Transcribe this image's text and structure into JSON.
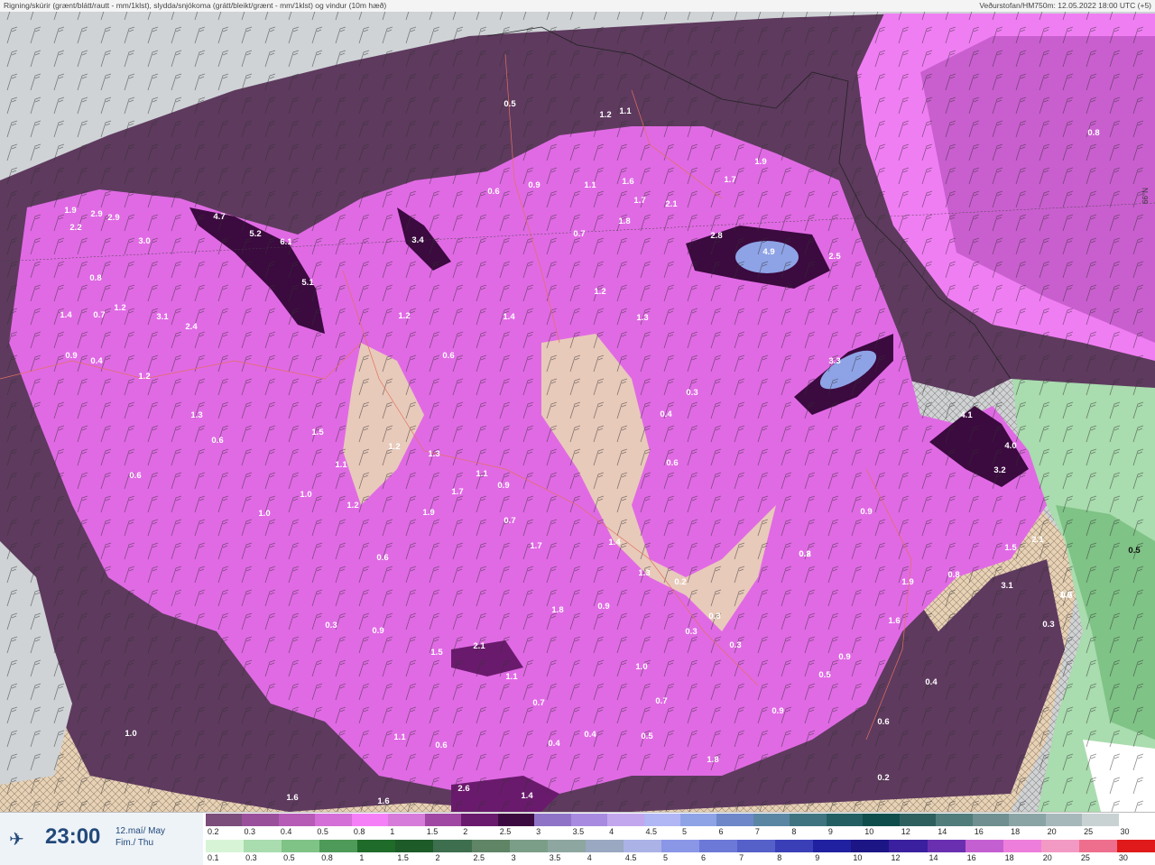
{
  "header": {
    "title": "Rigning/skúrir (grænt/blátt/rautt - mm/1klst), slydda/snjókoma (grátt/bleikt/grænt - mm/1klst) og vindur (10m hæð)",
    "source": "Veðurstofan/HM750m: 12.05.2022 18:00 UTC (+5)"
  },
  "time_panel": {
    "plane_icon": "airplane-icon",
    "time": "23:00",
    "date_line1": "12.maí/ May",
    "date_line2": "Fim./ Thu"
  },
  "grid_label": "66°N",
  "colors": {
    "sea": "#cfd3d6",
    "land": "#e8d2b6",
    "precip_light": "#5e3a5e",
    "precip_mid": "#e06ae4",
    "precip_bright": "#f07ef3",
    "precip_heavy": "#2e0a2e",
    "rain_green": "#a9dcae"
  },
  "legend_snow": {
    "labels": [
      "0.2",
      "0.3",
      "0.4",
      "0.5",
      "0.8",
      "1",
      "1.5",
      "2",
      "2.5",
      "3",
      "3.5",
      "4",
      "4.5",
      "5",
      "6",
      "7",
      "8",
      "9",
      "10",
      "12",
      "14",
      "16",
      "18",
      "20",
      "25",
      "30"
    ],
    "colors": [
      "#7a4d7a",
      "#9a4f9a",
      "#b65bb6",
      "#d36fd6",
      "#f57ff7",
      "#d67bd9",
      "#9f47a2",
      "#6a1a6d",
      "#3b0a3f",
      "#8e73c7",
      "#a88be0",
      "#c3a7ee",
      "#b1b6f5",
      "#8ea3e6",
      "#6d87c8",
      "#5a86a3",
      "#3f7380",
      "#235e62",
      "#0f4d4d",
      "#2e5f5f",
      "#507c7c",
      "#6f8f90",
      "#8aa4a6",
      "#a7b8ba",
      "#c9d2d3",
      "#ffffff"
    ]
  },
  "legend_rain": {
    "labels": [
      "0.1",
      "0.3",
      "0.5",
      "0.8",
      "1",
      "1.5",
      "2",
      "2.5",
      "3",
      "3.5",
      "4",
      "4.5",
      "5",
      "6",
      "7",
      "8",
      "9",
      "10",
      "12",
      "14",
      "16",
      "18",
      "20",
      "25",
      "30"
    ],
    "colors": [
      "#d7f5d6",
      "#a9dcae",
      "#7fc386",
      "#4e9a58",
      "#1f6b2a",
      "#1d5b28",
      "#3d6f4f",
      "#5f8466",
      "#7b9e88",
      "#8ea6a0",
      "#9aa8c2",
      "#aab2e6",
      "#8a96e6",
      "#6c79d6",
      "#5560c9",
      "#3a3fb8",
      "#2021a0",
      "#1c1586",
      "#3a1f9e",
      "#6a2fb0",
      "#c45fd1",
      "#ee7edb",
      "#f39ac4",
      "#ee6f8d",
      "#e01a1a"
    ]
  },
  "values": [
    "1.9",
    "2.9",
    "2.9",
    "2.2",
    "3.0",
    "4.7",
    "5.2",
    "6.1",
    "5.1",
    "3.4",
    "0.5",
    "1.2",
    "1.1",
    "0.9",
    "1.1",
    "1.6",
    "1.7",
    "2.1",
    "1.8",
    "1.9",
    "1.7",
    "2.8",
    "4.9",
    "2.5",
    "0.8",
    "0.6",
    "0.7",
    "1.2",
    "1.3",
    "1.4",
    "1.2",
    "0.6",
    "0.3",
    "0.4",
    "0.6",
    "3.3",
    "4.1",
    "4.0",
    "3.2",
    "0.9",
    "0.8",
    "1.5",
    "2.1",
    "3.1",
    "1.9",
    "1.6",
    "0.5",
    "0.8",
    "0.3",
    "0.8",
    "1.4",
    "0.7",
    "1.2",
    "3.1",
    "2.4",
    "1.2",
    "1.3",
    "0.6",
    "0.4",
    "0.9",
    "0.6",
    "1.0",
    "1.5",
    "1.1",
    "1.0",
    "1.2",
    "1.2",
    "1.3",
    "1.9",
    "1.7",
    "1.1",
    "0.9",
    "0.7",
    "1.7",
    "1.4",
    "1.3",
    "0.2",
    "0.3",
    "0.3",
    "0.3",
    "1.8",
    "0.9",
    "0.6",
    "0.3",
    "0.9",
    "1.5",
    "2.1",
    "1.1",
    "0.7",
    "1.0",
    "0.7",
    "0.5",
    "0.4",
    "0.4",
    "1.8",
    "0.6",
    "1.1",
    "1.6",
    "2.6",
    "1.4",
    "1.6",
    "1.0",
    "0.9",
    "0.5",
    "0.9",
    "0.4",
    "0.2",
    "0.6",
    "1.0",
    "0.5",
    "0.2"
  ]
}
